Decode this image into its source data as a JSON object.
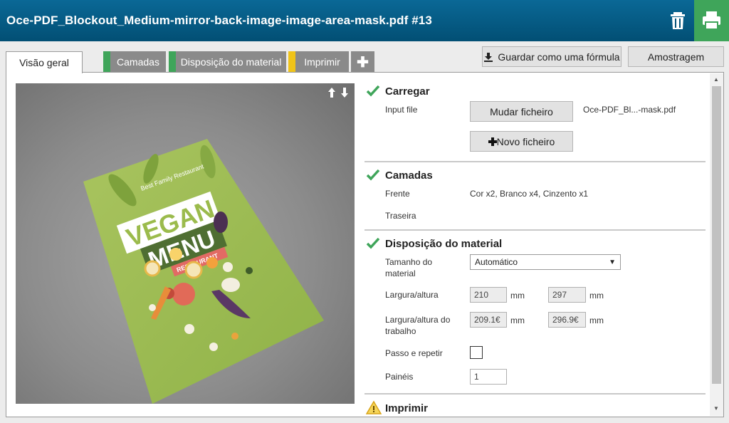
{
  "window": {
    "title": "Oce-PDF_Blockout_Medium-mirror-back-image-image-area-mask.pdf #13"
  },
  "header": {
    "trash_icon": "trash-icon",
    "print_icon": "print-icon",
    "print_color": "#3fa55a"
  },
  "tabs": [
    {
      "label": "Visão geral",
      "active": true
    },
    {
      "label": "Camadas",
      "marker_color": "#3fa55a"
    },
    {
      "label": "Disposição do material",
      "marker_color": "#3fa55a"
    },
    {
      "label": "Imprimir",
      "marker_color": "#f0c419"
    },
    {
      "label": "✚"
    }
  ],
  "toolbar": {
    "save_formula_label": "Guardar como uma fórmula",
    "sampling_label": "Amostragem"
  },
  "preview": {
    "arrows_icon": "up-down-arrows-icon",
    "poster": {
      "small_text": "Best Family Restaurant",
      "line1": "VEGAN",
      "line2": "MENU",
      "banner": "RESTAURANT"
    }
  },
  "sections": {
    "load": {
      "title": "Carregar",
      "status": "ok",
      "input_label": "Input file",
      "change_button": "Mudar ficheiro",
      "new_button": "Novo ficheiro",
      "file_name": "Oce-PDF_Bl...-mask.pdf"
    },
    "layers": {
      "title": "Camadas",
      "status": "ok",
      "front_label": "Frente",
      "front_value": "Cor x2, Branco x4, Cinzento x1",
      "back_label": "Traseira"
    },
    "media": {
      "title": "Disposição do material",
      "status": "ok",
      "size_label": "Tamanho do material",
      "size_value": "Automático",
      "wh_label": "Largura/altura",
      "width": "210",
      "height": "297",
      "unit": "mm",
      "job_wh_label": "Largura/altura do trabalho",
      "job_width": "209.1€",
      "job_height": "296.9€",
      "step_label": "Passo e repetir",
      "panels_label": "Painéis",
      "panels_value": "1"
    },
    "print": {
      "title": "Imprimir",
      "status": "warning"
    }
  }
}
